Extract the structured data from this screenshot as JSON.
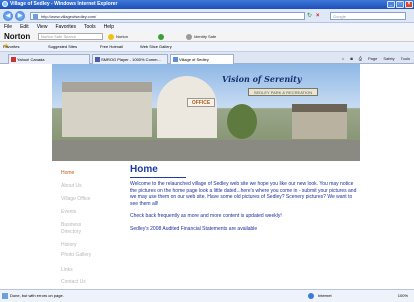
{
  "window": {
    "title": "Village of Sedley - Windows Internet Explorer"
  },
  "address": {
    "url": "http://www.villageofsedley.com/",
    "search_placeholder": "Google"
  },
  "menu": [
    "File",
    "Edit",
    "View",
    "Favorites",
    "Tools",
    "Help"
  ],
  "norton": {
    "logo": "Norton",
    "search_placeholder": "Norton Safe Search",
    "items": [
      "Norton",
      "Identity Safe"
    ]
  },
  "favorites_bar": {
    "label": "Favorites",
    "items": [
      "Suggested Sites",
      "Free Hotmail",
      "Web Slice Gallery"
    ]
  },
  "tabs": [
    {
      "label": "Yahoo! Canada"
    },
    {
      "label": "SMROG Player - 1000% Comm..."
    },
    {
      "label": "Village of Sedley"
    }
  ],
  "commandbar": [
    "Page",
    "Safety",
    "Tools"
  ],
  "banner": {
    "office_sign": "OFFICE",
    "tagline": "Vision of Serenity",
    "sign2": "SEDLEY PARK & RECREATION"
  },
  "sidebar": {
    "items": [
      {
        "label": "Home"
      },
      {
        "label": "About Us"
      },
      {
        "label": "Village Office"
      },
      {
        "label": "Events"
      },
      {
        "label": "Business"
      },
      {
        "label": "Directory"
      },
      {
        "label": "History"
      },
      {
        "label": "Photo Gallery"
      },
      {
        "label": "Links"
      },
      {
        "label": "Contact Us"
      }
    ]
  },
  "main": {
    "heading": "Home",
    "para1": "Welcome to the relaunched village of Sedley web site we hope you like our new look. You may notice the pictures on the home page look a little dated...here's where you come in - submit your pictures and we may use them on our web site. Have some old pictures of Sedley? Scenery pictures? We want to see them all!",
    "para2": "Check back frequently as more and more content is updated weekly!",
    "para3": "Sedley's 2008 Audited Financial Statements are available"
  },
  "status": {
    "text": "Done, but with errors on page.",
    "zone": "Internet",
    "zoom": "100%"
  }
}
